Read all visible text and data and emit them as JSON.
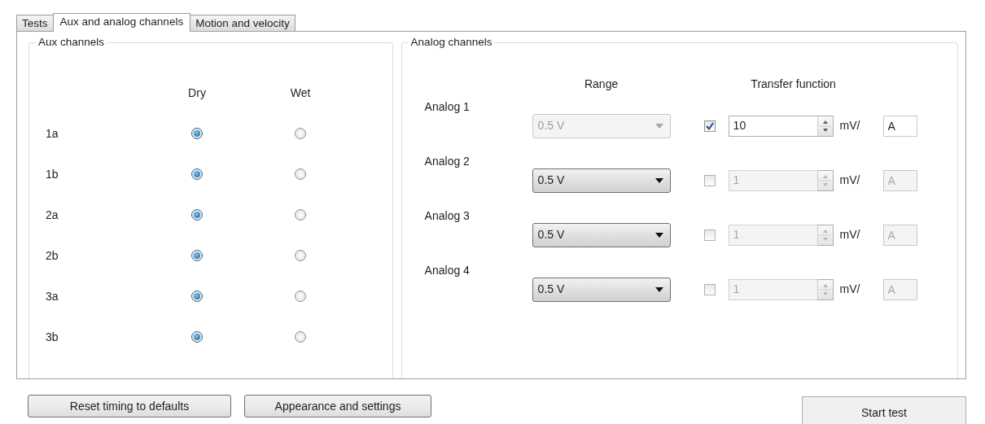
{
  "tabs": [
    {
      "label": "Tests",
      "selected": false
    },
    {
      "label": "Aux and analog channels",
      "selected": true
    },
    {
      "label": "Motion and velocity",
      "selected": false
    }
  ],
  "aux_channels": {
    "title": "Aux channels",
    "columns": [
      "Dry",
      "Wet"
    ],
    "rows": [
      {
        "label": "1a",
        "options": [
          {
            "selected": true
          },
          {
            "selected": false
          }
        ]
      },
      {
        "label": "1b",
        "options": [
          {
            "selected": true
          },
          {
            "selected": false
          }
        ]
      },
      {
        "label": "2a",
        "options": [
          {
            "selected": true
          },
          {
            "selected": false
          }
        ]
      },
      {
        "label": "2b",
        "options": [
          {
            "selected": true
          },
          {
            "selected": false
          }
        ]
      },
      {
        "label": "3a",
        "options": [
          {
            "selected": true
          },
          {
            "selected": false
          }
        ]
      },
      {
        "label": "3b",
        "options": [
          {
            "selected": true
          },
          {
            "selected": false
          }
        ]
      }
    ]
  },
  "analog_channels": {
    "title": "Analog channels",
    "range_header": "Range",
    "transfer_header": "Transfer function",
    "rows": [
      {
        "label": "Analog 1",
        "range": "0.5 V",
        "range_disabled": true,
        "checked": true,
        "factor": "10",
        "unit_prefix": "mV/",
        "unit": "A"
      },
      {
        "label": "Analog 2",
        "range": "0.5 V",
        "range_disabled": false,
        "checked": false,
        "factor": "1",
        "unit_prefix": "mV/",
        "unit": "A"
      },
      {
        "label": "Analog 3",
        "range": "0.5 V",
        "range_disabled": false,
        "checked": false,
        "factor": "1",
        "unit_prefix": "mV/",
        "unit": "A"
      },
      {
        "label": "Analog 4",
        "range": "0.5 V",
        "range_disabled": false,
        "checked": false,
        "factor": "1",
        "unit_prefix": "mV/",
        "unit": "A"
      }
    ]
  },
  "buttons": [
    {
      "label": "Reset timing to defaults",
      "kind": "left"
    },
    {
      "label": "Appearance and settings",
      "kind": "left"
    },
    {
      "label": "Start test",
      "kind": "right"
    }
  ]
}
